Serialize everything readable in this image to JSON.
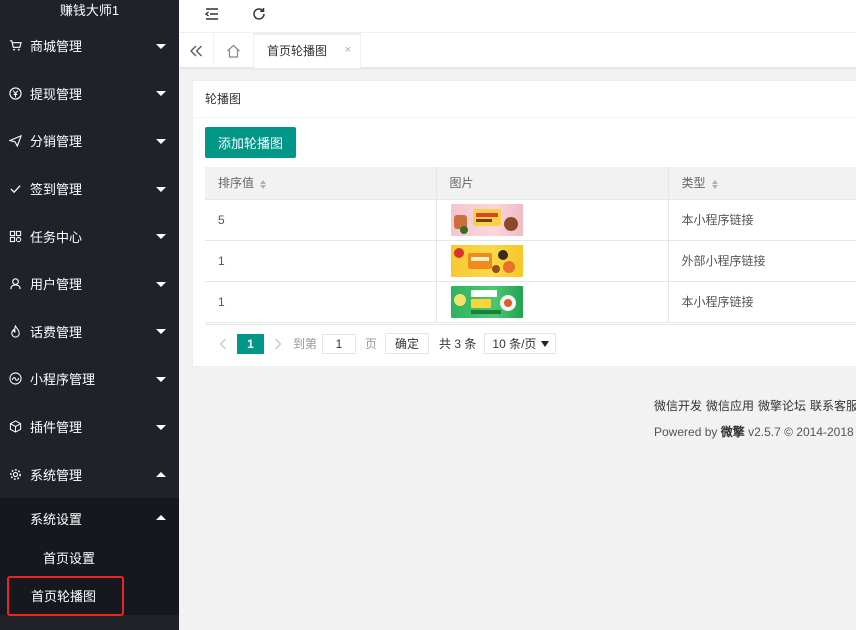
{
  "sidebar": {
    "logo": "赚钱大师1",
    "items": [
      {
        "label": "商城管理",
        "icon": "cart-icon"
      },
      {
        "label": "提现管理",
        "icon": "yen-icon"
      },
      {
        "label": "分销管理",
        "icon": "send-icon"
      },
      {
        "label": "签到管理",
        "icon": "check-icon"
      },
      {
        "label": "任务中心",
        "icon": "grid-icon"
      },
      {
        "label": "用户管理",
        "icon": "user-icon"
      },
      {
        "label": "话费管理",
        "icon": "fire-icon"
      },
      {
        "label": "小程序管理",
        "icon": "miniapp-icon"
      },
      {
        "label": "插件管理",
        "icon": "cube-icon"
      },
      {
        "label": "系统管理",
        "icon": "gear-icon"
      }
    ],
    "submenu": {
      "label": "系统设置",
      "children": [
        "首页设置",
        "首页轮播图"
      ]
    }
  },
  "topbar": {
    "menu_icon": "menu-fold-icon",
    "refresh_icon": "refresh-icon"
  },
  "tabs": {
    "active_tab": "首页轮播图",
    "close_glyph": "×"
  },
  "card": {
    "title": "轮播图",
    "add_button": "添加轮播图",
    "columns": [
      "排序值",
      "图片",
      "类型"
    ],
    "rows": [
      {
        "sort": "5",
        "image": "banner-1",
        "type": "本小程序链接"
      },
      {
        "sort": "1",
        "image": "banner-2",
        "type": "外部小程序链接"
      },
      {
        "sort": "1",
        "image": "banner-3",
        "type": "本小程序链接"
      }
    ]
  },
  "pager": {
    "current": "1",
    "goto_label": "到第",
    "page_input": "1",
    "page_unit": "页",
    "confirm": "确定",
    "total": "共 3 条",
    "page_size": "10 条/页"
  },
  "footer": {
    "links": [
      "微信开发",
      "微信应用",
      "微擎论坛",
      "联系客服"
    ],
    "powered_prefix": "Powered by",
    "brand": "微擎",
    "version": "v2.5.7 © 2014-2018"
  },
  "colors": {
    "sidebar_bg": "#20222a",
    "accent": "#009688",
    "highlight_border": "#e8261f"
  }
}
